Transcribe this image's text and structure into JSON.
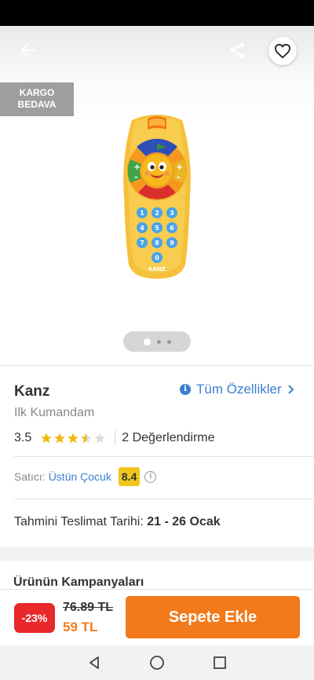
{
  "header": {
    "back_icon": "arrow-left-icon",
    "share_icon": "share-icon",
    "favorite_icon": "heart-outline-icon"
  },
  "badge": {
    "line1": "KARGO",
    "line2": "BEDAVA"
  },
  "product": {
    "image": "toy-remote-control",
    "image_count": 3,
    "active_image": 1,
    "brand": "Kanz",
    "name": "Ilk Kumandam",
    "all_specs_label": "Tüm Özellikler",
    "rating": "3.5",
    "stars_filled_fraction": 0.7,
    "review_count_label": "2 Değerlendirme"
  },
  "seller": {
    "label": "Satıcı:",
    "name": "Üstün Çocuk",
    "score": "8.4"
  },
  "delivery": {
    "label": "Tahmini Teslimat Tarihi:",
    "dates": "21 - 26 Ocak"
  },
  "campaigns": {
    "title": "Ürünün Kampanyaları"
  },
  "purchase": {
    "discount": "-23%",
    "old_price": "76.89 TL",
    "new_price": "59 TL",
    "add_to_cart_label": "Sepete Ekle"
  },
  "colors": {
    "accent": "#f27a1a",
    "link": "#3a7fd1",
    "discount": "#e8282b",
    "seller_score": "#efc61b",
    "star": "#f2b90c"
  },
  "navigation": {
    "back": "nav-back-icon",
    "home": "nav-home-icon",
    "recents": "nav-recents-icon"
  }
}
